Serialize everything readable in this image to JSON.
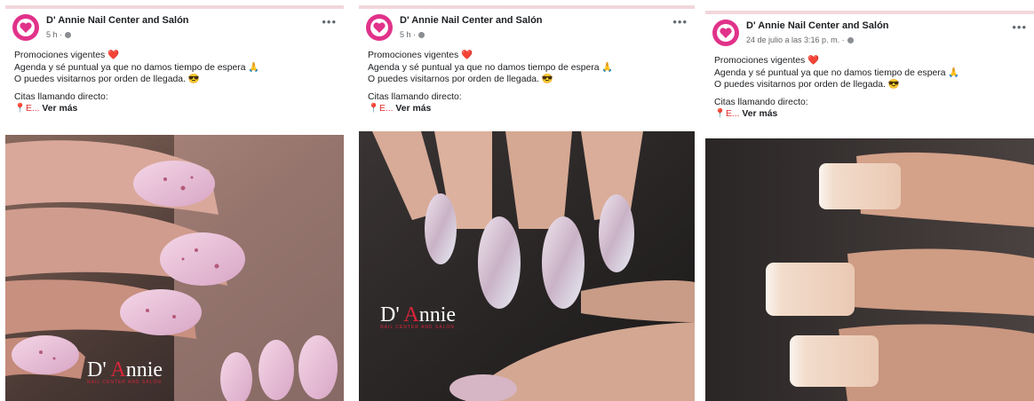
{
  "posts": [
    {
      "page_name": "D' Annie Nail Center and Salón",
      "time": "5 h ·",
      "lines": [
        "Promociones vigentes ❤️",
        "Agenda y sé puntual ya que no damos tiempo de espera 🙏",
        "O puedes visitarnos por orden de llegada. 😎"
      ],
      "lines2": [
        "Citas llamando directo:"
      ],
      "truncated": "📍E...",
      "see_more": "Ver más",
      "more_icon": "•••",
      "logo_main_pre": "D' ",
      "logo_main_a": "A",
      "logo_main_post": "nnie",
      "logo_sub": "NAIL CENTER AND SALON"
    },
    {
      "page_name": "D' Annie Nail Center and Salón",
      "time": "5 h ·",
      "lines": [
        "Promociones vigentes ❤️",
        "Agenda y sé puntual ya que no damos tiempo de espera 🙏",
        "O puedes visitarnos por orden de llegada. 😎"
      ],
      "lines2": [
        "Citas llamando directo:"
      ],
      "truncated": "📍E...",
      "see_more": "Ver más",
      "more_icon": "•••",
      "logo_main_pre": "D' ",
      "logo_main_a": "A",
      "logo_main_post": "nnie",
      "logo_sub": "NAIL CENTER AND SALON"
    },
    {
      "page_name": "D' Annie Nail Center and Salón",
      "time": "24 de julio a las 3:16 p. m. ·",
      "lines": [
        "Promociones vigentes ❤️",
        "Agenda y sé puntual ya que no damos tiempo de espera 🙏",
        "O puedes visitarnos por orden de llegada. 😎"
      ],
      "lines2": [
        "Citas llamando directo:"
      ],
      "truncated": "📍E...",
      "see_more": "Ver más",
      "more_icon": "•••"
    }
  ],
  "colors": {
    "brand": "#e1328a",
    "logo_red": "#d9253a",
    "text": "#1c1e21",
    "meta": "#65676b"
  },
  "icons": {
    "avatar": "heart-logo-icon",
    "privacy": "globe-icon",
    "more": "more-options-icon",
    "pin": "pushpin-icon"
  }
}
